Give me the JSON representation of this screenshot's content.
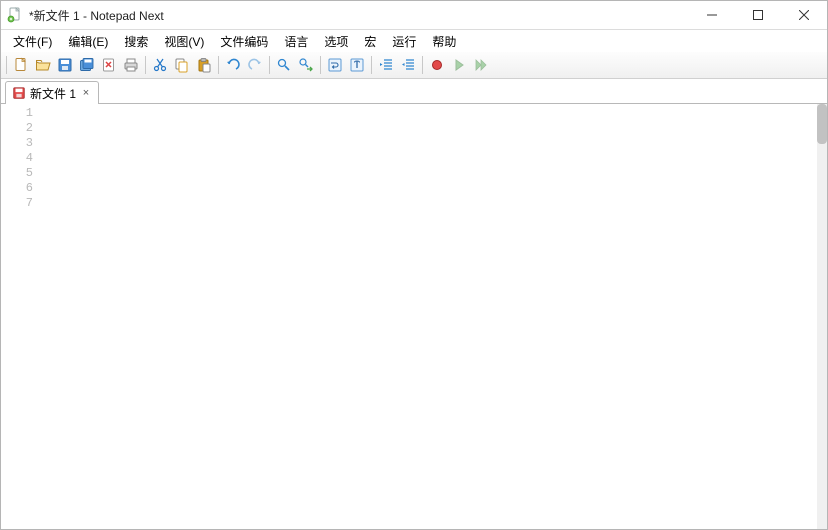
{
  "window": {
    "title": "*新文件 1 - Notepad Next"
  },
  "menu": {
    "file": "文件(F)",
    "edit": "编辑(E)",
    "search": "搜索",
    "view": "视图(V)",
    "encoding": "文件编码",
    "language": "语言",
    "options": "选项",
    "macro": "宏",
    "run": "运行",
    "help": "帮助"
  },
  "toolbar": {
    "new": "new",
    "open": "open",
    "save": "save",
    "saveall": "save-all",
    "close": "close",
    "print": "print",
    "cut": "cut",
    "copy": "copy",
    "paste": "paste",
    "undo": "undo",
    "redo": "redo",
    "find": "find",
    "replace": "replace",
    "wrap": "word-wrap",
    "whitespace": "whitespace",
    "indent": "indent",
    "outdent": "outdent",
    "record": "macro-record",
    "play": "macro-play",
    "playmulti": "macro-play-multi"
  },
  "tabs": [
    {
      "label": "新文件 1",
      "modified": true
    }
  ],
  "editor": {
    "line_count": 7,
    "lines": [
      "1",
      "2",
      "3",
      "4",
      "5",
      "6",
      "7"
    ]
  }
}
